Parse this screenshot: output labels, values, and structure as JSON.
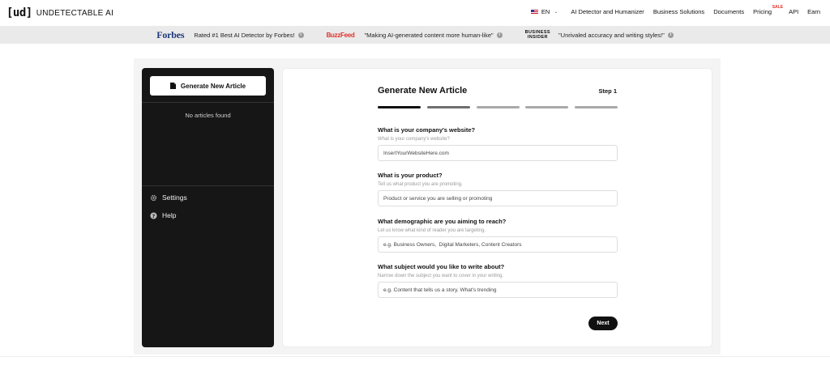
{
  "brand": {
    "mark": "[ud]",
    "name": "UNDETECTABLE AI"
  },
  "nav": {
    "language": "EN",
    "items": [
      "AI Detector and Humanizer",
      "Business Solutions",
      "Documents"
    ],
    "pricing": "Pricing",
    "sale_badge": "SALE",
    "api": "API",
    "earn": "Earn"
  },
  "press": [
    {
      "source": "Forbes",
      "quote": "Rated #1 Best AI Detector by Forbes!"
    },
    {
      "source": "BuzzFeed",
      "quote": "\"Making AI-generated content more human-like\""
    },
    {
      "source_line1": "BUSINESS",
      "source_line2": "INSIDER",
      "quote": "\"Unrivaled accuracy and writing styles!\""
    }
  ],
  "sidebar": {
    "new_article_label": "Generate New Article",
    "empty_text": "No articles found",
    "settings_label": "Settings",
    "help_label": "Help"
  },
  "form": {
    "title": "Generate New Article",
    "step": "Step 1",
    "current_step": 1,
    "total_steps": 5,
    "fields": [
      {
        "question": "What is your company's website?",
        "hint": "What is your company's website?",
        "placeholder": "InsertYourWebsiteHere.com"
      },
      {
        "question": "What is your product?",
        "hint": "Tell us what product you are promoting.",
        "placeholder": "Product or service you are selling or promoting"
      },
      {
        "question": "What demographic are you aiming to reach?",
        "hint": "Let us know what kind of reader you are targeting.",
        "placeholder": "e.g. Business Owners,  Digital Marketers, Content Creators"
      },
      {
        "question": "What subject would you like to write about?",
        "hint": "Narrow down the subject you want to cover in your writing.",
        "placeholder": "e.g. Content that tells us a story, What's trending"
      }
    ],
    "next_label": "Next"
  },
  "colors": {
    "accent": "#111111",
    "sale": "#e0322b",
    "forbes": "#1f3a7a",
    "progress_active": "#111111",
    "progress_next": "#6f6f6f",
    "progress_inactive": "#a9a9a9"
  }
}
